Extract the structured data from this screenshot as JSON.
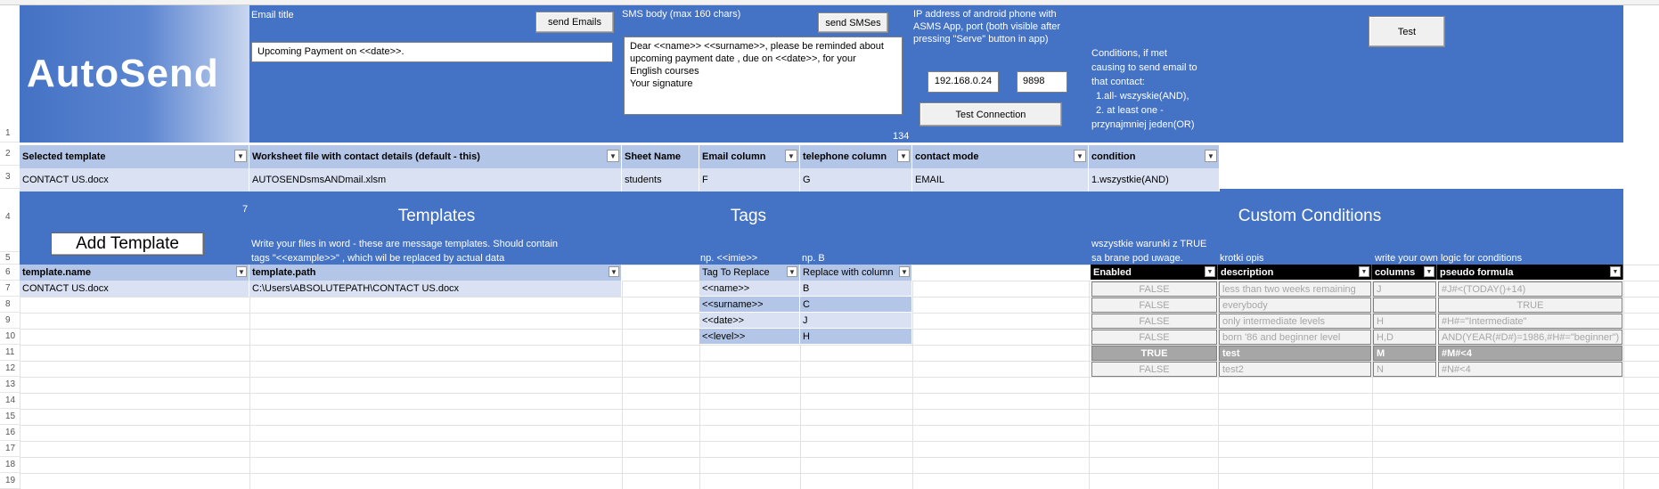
{
  "app": {
    "title": "AutoSend"
  },
  "row_numbers": [
    "1",
    "2",
    "3",
    "4",
    "5",
    "6",
    "7",
    "8",
    "9",
    "10",
    "11",
    "12",
    "13",
    "14",
    "15",
    "16",
    "17",
    "18",
    "19"
  ],
  "top": {
    "email_title_label": "Email title",
    "send_emails_button": "send Emails",
    "email_title_value": "Upcoming Payment on <<date>>.",
    "sms_body_label": "SMS body (max 160 chars)",
    "send_smses_button": "send SMSes",
    "sms_body_line1": "Dear <<name>> <<surname>>, please be reminded about",
    "sms_body_line2": "upcoming payment date , due on <<date>>, for your",
    "sms_body_line3": "English courses",
    "sms_body_line4": "Your signature",
    "sms_char_count": "134",
    "ip_label_line1": "IP address of android phone with",
    "ip_label_line2": "ASMS App, port (both visible after",
    "ip_label_line3": "pressing \"Serve\" button in app)",
    "ip_value": "192.168.0.24",
    "port_value": "9898",
    "test_connection_button": "Test Connection",
    "conditions_line1": "Conditions, if met",
    "conditions_line2": "causing to send email to",
    "conditions_line3": "that contact:",
    "conditions_line4": "1.all- wszyskie(AND),",
    "conditions_line5": "2. at least one -",
    "conditions_line6": "przynajmniej jeden(OR)",
    "test_button": "Test"
  },
  "settings_table": {
    "headers": [
      "Selected template",
      "Worksheet file with contact details (default - this)",
      "Sheet Name",
      "Email column",
      "telephone column",
      "contact mode",
      "condition"
    ],
    "values": [
      "CONTACT US.docx",
      "AUTOSENDsmsANDmail.xlsm",
      "students",
      "F",
      "G",
      "EMAIL",
      "1.wszystkie(AND)"
    ]
  },
  "sections": {
    "templates_title": "Templates",
    "tags_title": "Tags",
    "custom_conditions_title": "Custom Conditions",
    "template_count": "7",
    "add_template_button": "Add Template",
    "templates_desc_line1": "Write your files in word - these are message templates. Should contain",
    "templates_desc_line2": "tags \"<<example>>\" , which wil be replaced by actual data",
    "tags_hint_1": "np. <<imie>>",
    "tags_hint_2": "np. B",
    "cc_hint_line1": "wszystkie warunki z TRUE",
    "cc_hint_line2": "sa brane pod uwage.",
    "cc_hint_desc": "krotki opis",
    "cc_hint_logic": "write your own logic for conditions"
  },
  "templates_table": {
    "headers": [
      "template.name",
      "template.path"
    ],
    "rows": [
      [
        "CONTACT US.docx",
        "C:\\Users\\ABSOLUTEPATH\\CONTACT US.docx"
      ]
    ]
  },
  "tags_table": {
    "headers": [
      "Tag To Replace",
      "Replace with column"
    ],
    "rows": [
      [
        "<<name>>",
        "B"
      ],
      [
        "<<surname>>",
        "C"
      ],
      [
        "<<date>>",
        "J"
      ],
      [
        "<<level>>",
        "H"
      ]
    ]
  },
  "conditions_table": {
    "headers": [
      "Enabled",
      "description",
      "columns",
      "pseudo formula"
    ],
    "rows": [
      [
        "FALSE",
        "less than two weeks remaining",
        "J",
        "#J#<(TODAY()+14)"
      ],
      [
        "FALSE",
        "everybody",
        "",
        "TRUE"
      ],
      [
        "FALSE",
        "only intermediate levels",
        "H",
        "#H#=\"Intermediate\""
      ],
      [
        "FALSE",
        " born '86 and beginner level",
        "H,D",
        "AND(YEAR(#D#)=1986,#H#=\"beginner\")"
      ],
      [
        "TRUE",
        "test",
        "M",
        "#M#<4"
      ],
      [
        "FALSE",
        "test2",
        "N",
        "#N#<4"
      ]
    ]
  },
  "colors": {
    "banner_blue": "#4472c4",
    "header_light_blue": "#b4c6e7",
    "row_light_blue": "#d9e1f2"
  }
}
